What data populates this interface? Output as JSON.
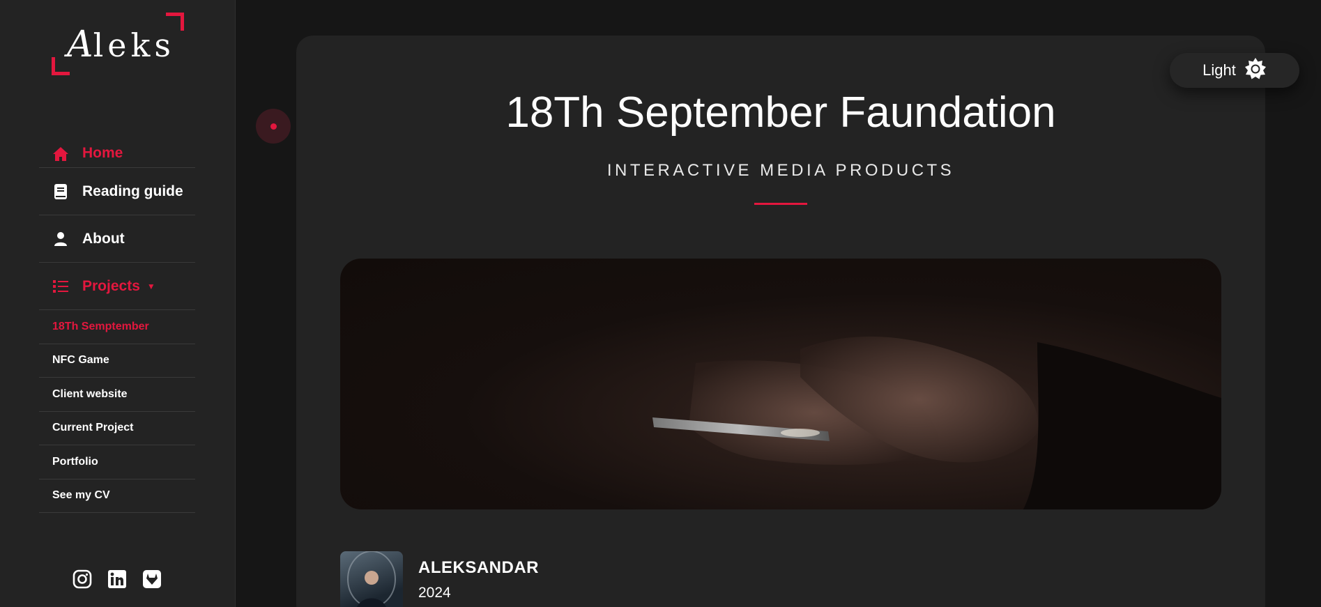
{
  "logo": {
    "text_cap": "A",
    "text_rest": "leks"
  },
  "nav": {
    "items": [
      {
        "label": "Home",
        "icon": "home-icon",
        "active": true
      },
      {
        "label": "Reading guide",
        "icon": "book-icon",
        "active": false
      },
      {
        "label": "About",
        "icon": "user-icon",
        "active": false
      },
      {
        "label": "Projects",
        "icon": "list-icon",
        "active": true
      }
    ],
    "projects": [
      {
        "label": "18Th Semptember",
        "active": true
      },
      {
        "label": "NFC Game",
        "active": false
      },
      {
        "label": "Client website",
        "active": false
      },
      {
        "label": "Current Project",
        "active": false
      },
      {
        "label": "Portfolio",
        "active": false
      },
      {
        "label": "See my CV",
        "active": false
      }
    ]
  },
  "social": [
    "instagram-icon",
    "linkedin-icon",
    "gitlab-icon"
  ],
  "theme_toggle": {
    "label": "Light",
    "icon": "sun-icon"
  },
  "page": {
    "title": "18Th September Faundation",
    "subtitle": "INTERACTIVE MEDIA PRODUCTS"
  },
  "author": {
    "name": "ALEKSANDAR",
    "year": "2024"
  },
  "colors": {
    "accent": "#e3173e",
    "sidebar_bg": "#232323",
    "page_bg": "#161616",
    "card_bg": "#232323"
  }
}
